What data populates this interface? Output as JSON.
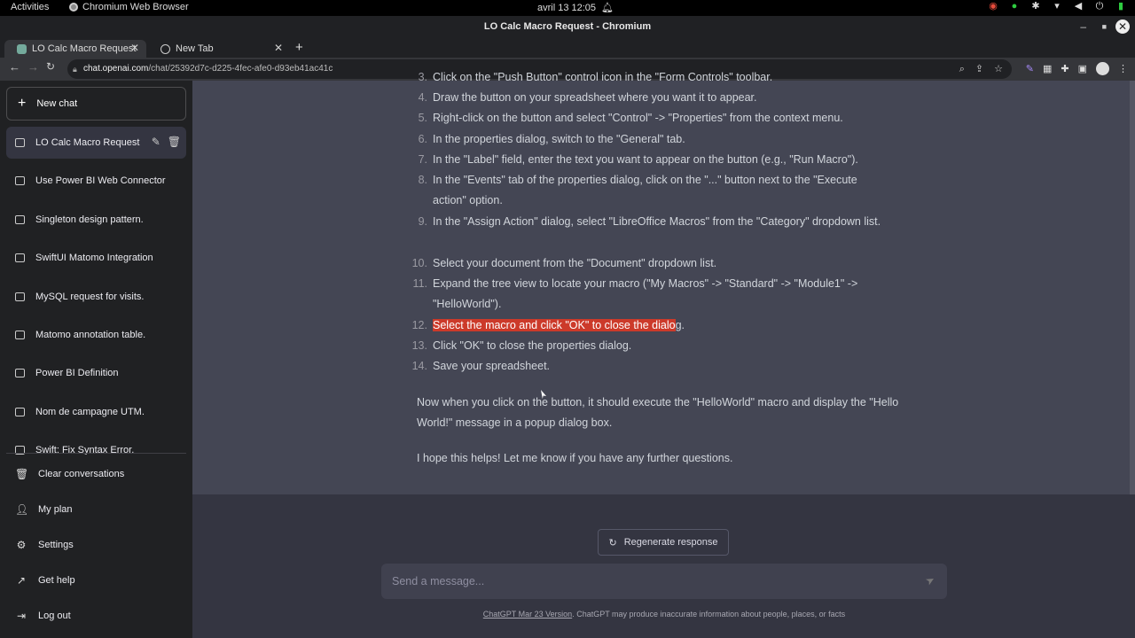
{
  "system": {
    "activities": "Activities",
    "app_name": "Chromium Web Browser",
    "clock": "avril 13  12:05"
  },
  "window": {
    "title": "LO Calc Macro Request - Chromium"
  },
  "browser": {
    "tabs": [
      {
        "label": "LO Calc Macro Request"
      },
      {
        "label": "New Tab"
      }
    ],
    "url_host": "chat.openai.com",
    "url_path": "/chat/25392d7c-d225-4fec-afe0-d93eb41ac41c"
  },
  "sidebar": {
    "new_chat": "New chat",
    "conversations": [
      {
        "label": "LO Calc Macro Request"
      },
      {
        "label": "Use Power BI Web Connector"
      },
      {
        "label": "Singleton design pattern."
      },
      {
        "label": "SwiftUI Matomo Integration"
      },
      {
        "label": "MySQL request for visits."
      },
      {
        "label": "Matomo annotation table."
      },
      {
        "label": "Power BI Definition"
      },
      {
        "label": "Nom de campagne UTM."
      },
      {
        "label": "Swift: Fix Syntax Error."
      }
    ],
    "actions": [
      {
        "label": "Clear conversations"
      },
      {
        "label": "My plan"
      },
      {
        "label": "Settings"
      },
      {
        "label": "Get help"
      },
      {
        "label": "Log out"
      }
    ]
  },
  "message": {
    "partial_top": "Click on the \"Push Button\" control icon in the \"Form Controls\" toolbar.",
    "steps": [
      {
        "n": "4.",
        "text": "Draw the button on your spreadsheet where you want it to appear."
      },
      {
        "n": "5.",
        "text": "Right-click on the button and select \"Control\" -> \"Properties\" from the context menu."
      },
      {
        "n": "6.",
        "text": "In the properties dialog, switch to the \"General\" tab."
      },
      {
        "n": "7.",
        "text": "In the \"Label\" field, enter the text you want to appear on the button (e.g., \"Run Macro\")."
      },
      {
        "n": "8.",
        "text": "In the \"Events\" tab of the properties dialog, click on the \"...\" button next to the \"Execute action\" option."
      },
      {
        "n": "9.",
        "text": "In the \"Assign Action\" dialog, select \"LibreOffice Macros\" from the \"Category\" dropdown list."
      },
      {
        "n": "10.",
        "text": "Select your document from the \"Document\" dropdown list."
      },
      {
        "n": "11.",
        "text": "Expand the tree view to locate your macro (\"My Macros\" -> \"Standard\" -> \"Module1\" -> \"HelloWorld\")."
      },
      {
        "n": "12.",
        "text_highlighted": "Select the macro and click \"OK\" to close the dialo",
        "text_rest": "g."
      },
      {
        "n": "13.",
        "text": "Click \"OK\" to close the properties dialog."
      },
      {
        "n": "14.",
        "text": "Save your spreadsheet."
      }
    ],
    "closing_1": "Now when you click on the button, it should execute the \"HelloWorld\" macro and display the \"Hello World!\" message in a popup dialog box.",
    "closing_2": "I hope this helps! Let me know if you have any further questions."
  },
  "composer": {
    "regenerate": "Regenerate response",
    "placeholder": "Send a message...",
    "footer_version": "ChatGPT Mar 23 Version",
    "footer_text": ". ChatGPT may produce inaccurate information about people, places, or facts"
  },
  "colors": {
    "highlight": "#cc3a2a",
    "sidebar_bg": "#202123",
    "main_bg": "#343541",
    "message_bg": "#444654"
  }
}
